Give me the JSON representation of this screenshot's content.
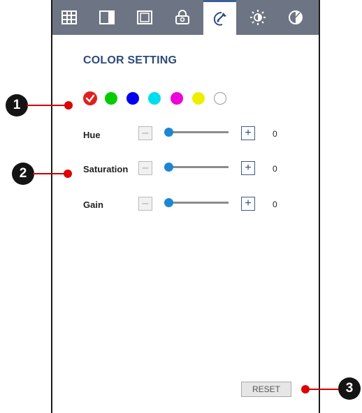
{
  "tabs": [
    {
      "name": "grid-icon"
    },
    {
      "name": "split-panel-icon"
    },
    {
      "name": "frame-icon"
    },
    {
      "name": "lock-icon"
    },
    {
      "name": "color-picker-icon",
      "active": true
    },
    {
      "name": "brightness-icon"
    },
    {
      "name": "contrast-icon"
    }
  ],
  "title": "COLOR SETTING",
  "colors": {
    "selected": "#e02020",
    "swatches": [
      "#e02020",
      "#00cc00",
      "#0000ee",
      "#00ddee",
      "#ee00dd",
      "#eeee00",
      "#ffffff"
    ],
    "accent": "#1b87d4",
    "callout": "#e00000"
  },
  "controls": [
    {
      "label": "Hue",
      "value": "0",
      "level": 0
    },
    {
      "label": "Saturation",
      "value": "0",
      "level": 0
    },
    {
      "label": "Gain",
      "value": "0",
      "level": 0
    }
  ],
  "buttons": {
    "minus": "–",
    "plus": "+"
  },
  "reset_label": "RESET",
  "callouts": [
    "1",
    "2",
    "3"
  ]
}
